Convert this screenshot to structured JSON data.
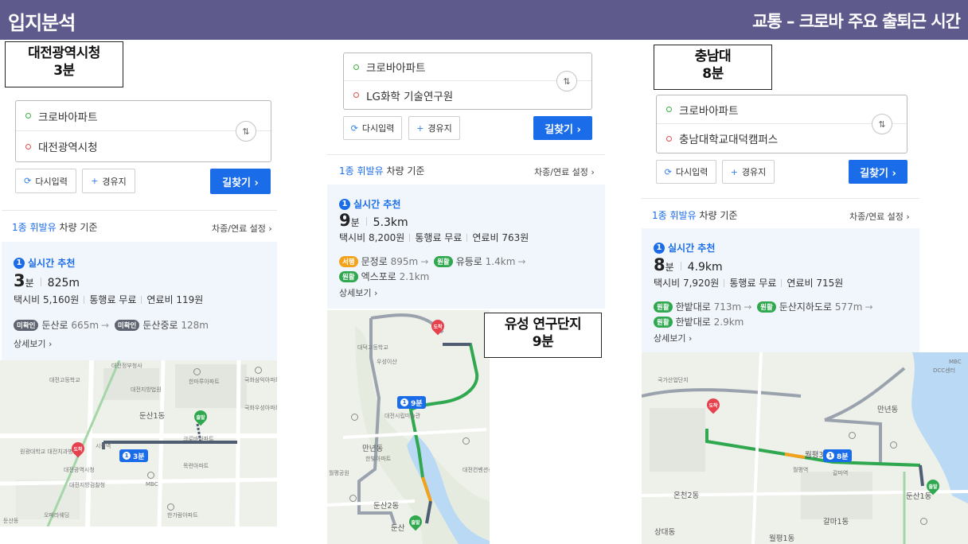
{
  "header": {
    "title_left": "입지분석",
    "title_right": "교통 – 크로바 주요 출퇴근 시간"
  },
  "common": {
    "swap": "⇅",
    "reset": "다시입력",
    "waypoint": "경유지",
    "go": "길찾기 ›",
    "criteria_fuel": "1종 휘발유",
    "criteria_rest": " 차량 기준",
    "setting": "차종/연료 설정 ›",
    "rec_num": "1",
    "rec_label": "실시간 추천",
    "time_unit": "분",
    "detail": "상세보기 ›",
    "taxi_label": "택시비",
    "toll": "통행료 무료",
    "fuel_label": "연료비"
  },
  "panels": [
    {
      "label_name": "대전광역시청",
      "label_time": "3분",
      "origin": "크로바아파트",
      "destination": "대전광역시청",
      "minutes": "3",
      "distance": "825m",
      "taxi": "5,160원",
      "fuel": "119원",
      "roads": [
        {
          "badge": "미확인",
          "color": "gray",
          "name": "둔산로",
          "dist": "665m"
        },
        {
          "badge": "미확인",
          "color": "gray",
          "name": "둔산중로",
          "dist": "128m"
        }
      ],
      "map": {
        "dong": "둔산1동",
        "chip": "3분",
        "start": "출발",
        "end": "도착",
        "places": [
          "대전정부청사",
          "국화삼익아파트",
          "한마루아파트",
          "대전지방법원",
          "대전고등학교",
          "국화우성아파트",
          "크로바아파트",
          "목련아파트",
          "대전광역시청",
          "원광대학교 대전치과병원",
          "MBC",
          "대전지방검찰청",
          "한가람아파트",
          "둔산동",
          "오페라웨딩",
          "시청역"
        ]
      }
    },
    {
      "label_name": "유성 연구단지",
      "label_time": "9분",
      "origin": "크로바아파트",
      "destination": "LG화학 기술연구원",
      "minutes": "9",
      "distance": "5.3km",
      "taxi": "8,200원",
      "fuel": "763원",
      "roads": [
        {
          "badge": "서행",
          "color": "orange",
          "name": "문정로",
          "dist": "895m"
        },
        {
          "badge": "원활",
          "color": "green",
          "name": "유등로",
          "dist": "1.4km"
        },
        {
          "badge": "원활",
          "color": "green",
          "name": "엑스포로",
          "dist": "2.1km"
        }
      ],
      "map": {
        "dong": "만년동",
        "dong2": "둔산2동",
        "dong3": "둔산",
        "chip": "9분",
        "start": "출발",
        "end": "도착",
        "places": [
          "대덕고등학교",
          "우성이산",
          "대전시립미술관",
          "한빛아파트",
          "대전컨벤션센터",
          "월평공원"
        ]
      }
    },
    {
      "label_name": "충남대",
      "label_time": "8분",
      "origin": "크로바아파트",
      "destination": "충남대학교대덕캠퍼스",
      "minutes": "8",
      "distance": "4.9km",
      "taxi": "7,920원",
      "fuel": "715원",
      "roads": [
        {
          "badge": "원활",
          "color": "green",
          "name": "한밭대로",
          "dist": "713m"
        },
        {
          "badge": "원활",
          "color": "green",
          "name": "둔산지하도로",
          "dist": "577m"
        },
        {
          "badge": "원활",
          "color": "green",
          "name": "한밭대로",
          "dist": "2.9km"
        }
      ],
      "map": {
        "dong": "월평3동",
        "dong2": "만년동",
        "dong3": "둔산1동",
        "dong4": "온천2동",
        "dong5": "갈마1동",
        "dong6": "상대동",
        "dong7": "월평1동",
        "chip": "8분",
        "start": "출발",
        "end": "도착",
        "places": [
          "국가산업단지",
          "월평역",
          "갈마역",
          "MBC",
          "DCC센터"
        ]
      }
    }
  ],
  "colors": {
    "header": "#5e5a8c",
    "accent": "#1a6ce8",
    "route_panel": "#f1f6fd",
    "traffic_green": "#2fa84f",
    "traffic_orange": "#f3a21a"
  }
}
